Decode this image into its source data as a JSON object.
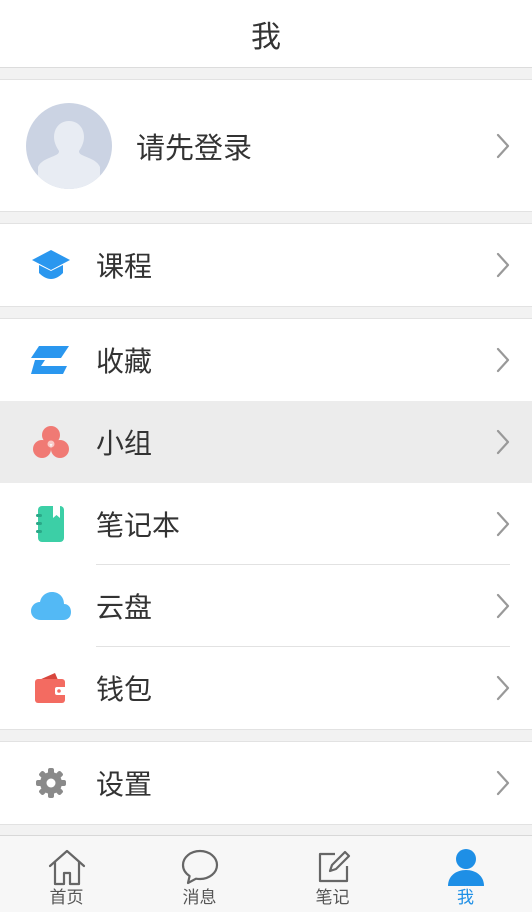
{
  "header": {
    "title": "我"
  },
  "profile": {
    "login_text": "请先登录",
    "avatar_icon": "user-silhouette-icon"
  },
  "menu": {
    "courses": {
      "label": "课程",
      "icon": "graduation-cap-icon",
      "color": "#2a97ef"
    },
    "favorites": {
      "label": "收藏",
      "icon": "stacked-layers-icon",
      "color": "#2a97ef"
    },
    "groups": {
      "label": "小组",
      "icon": "three-circles-icon",
      "color": "#f07a74"
    },
    "notebook": {
      "label": "笔记本",
      "icon": "notebook-icon",
      "color": "#3ccfa6"
    },
    "cloud": {
      "label": "云盘",
      "icon": "cloud-icon",
      "color": "#53b9f5"
    },
    "wallet": {
      "label": "钱包",
      "icon": "wallet-icon",
      "color": "#f36b61"
    },
    "settings": {
      "label": "设置",
      "icon": "gear-icon",
      "color": "#8a8a8a"
    }
  },
  "tabs": [
    {
      "label": "首页",
      "icon": "home-icon"
    },
    {
      "label": "消息",
      "icon": "chat-bubble-icon"
    },
    {
      "label": "笔记",
      "icon": "edit-note-icon"
    },
    {
      "label": "我",
      "icon": "user-icon",
      "active": true
    }
  ],
  "colors": {
    "accent": "#1e8fe6",
    "highlight_row": "#ececec"
  }
}
